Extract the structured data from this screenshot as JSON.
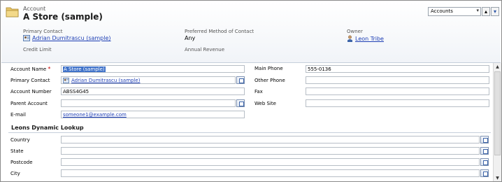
{
  "header": {
    "entity_label": "Account",
    "record_title": "A Store (sample)",
    "fields": {
      "primary_contact_label": "Primary Contact",
      "primary_contact_value": "Adrian Dumitrascu (sample)",
      "credit_limit_label": "Credit Limit",
      "preferred_contact_label": "Preferred Method of Contact",
      "preferred_contact_value": "Any",
      "annual_revenue_label": "Annual Revenue",
      "owner_label": "Owner",
      "owner_value": "Leon Tribe"
    },
    "view_selector": "Accounts",
    "nav_up": "▴",
    "nav_down": "▾"
  },
  "form": {
    "account_name_label": "Account Name",
    "required_mark": "*",
    "account_name_value": "A Store (sample)",
    "primary_contact_label": "Primary Contact",
    "primary_contact_value": "Adrian Dumitrascu (sample)",
    "account_number_label": "Account Number",
    "account_number_value": "ABSS4G45",
    "parent_account_label": "Parent Account",
    "email_label": "E-mail",
    "email_value": "someone1@example.com",
    "main_phone_label": "Main Phone",
    "main_phone_value": "555-0136",
    "other_phone_label": "Other Phone",
    "fax_label": "Fax",
    "website_label": "Web Site"
  },
  "section": {
    "title": "Leons Dynamic Lookup",
    "fields": [
      {
        "label": "Country"
      },
      {
        "label": "State"
      },
      {
        "label": "Postcode"
      },
      {
        "label": "City"
      }
    ]
  },
  "colors": {
    "link": "#1e3fb5",
    "selection": "#3f72c9",
    "required": "#cc0000"
  }
}
